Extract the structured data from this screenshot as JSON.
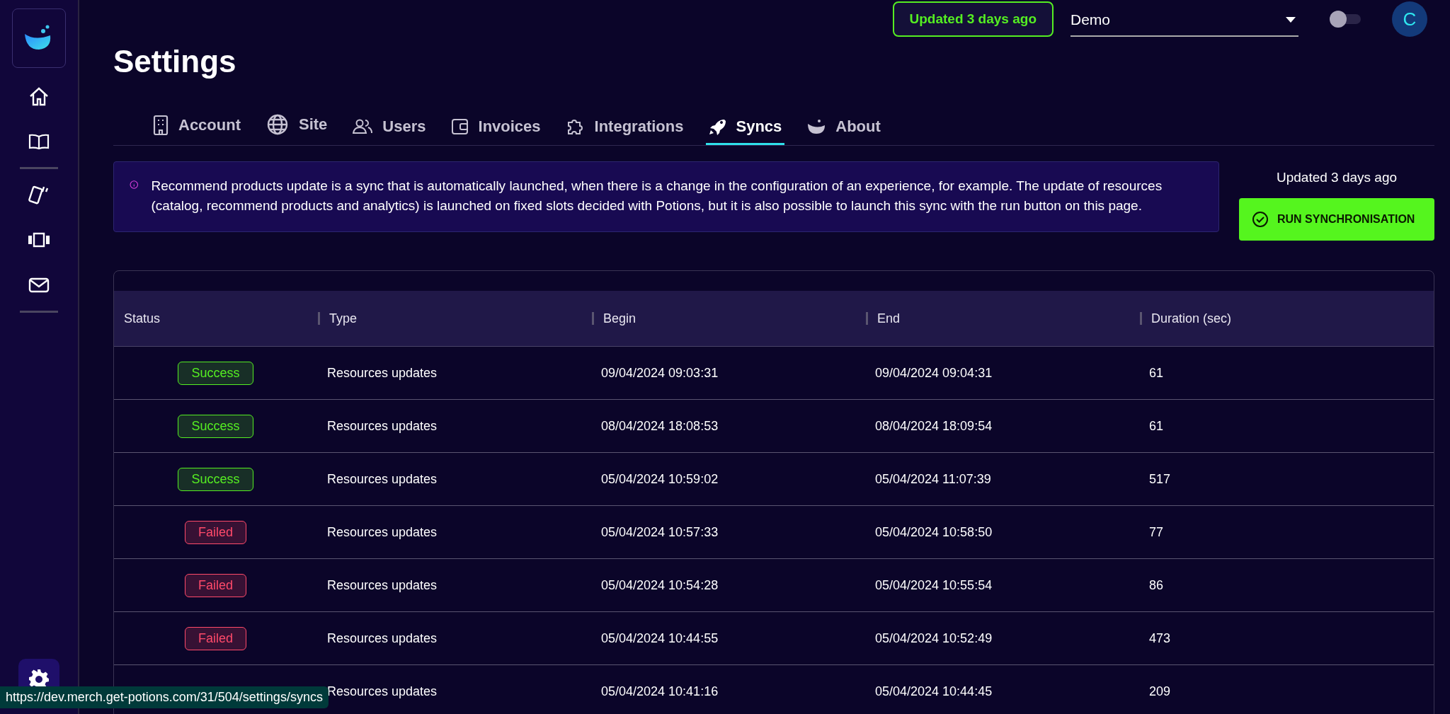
{
  "topbar": {
    "updated_badge": "Updated 3 days ago",
    "project_select": {
      "value": "Demo"
    },
    "theme_toggle": {
      "on": false
    },
    "avatar": "C"
  },
  "sidebar": {
    "items": [
      {
        "kind": "home"
      },
      {
        "kind": "book"
      },
      {
        "kind": "divider"
      },
      {
        "kind": "cards"
      },
      {
        "kind": "carousel"
      },
      {
        "kind": "mail"
      },
      {
        "kind": "divider"
      }
    ],
    "settings_selected": true
  },
  "page_title": "Settings",
  "tabs": [
    {
      "label": "Account",
      "selected": false
    },
    {
      "label": "Site",
      "selected": false
    },
    {
      "label": "Users",
      "selected": false
    },
    {
      "label": "Invoices",
      "selected": false
    },
    {
      "label": "Integrations",
      "selected": false
    },
    {
      "label": "Syncs",
      "selected": true
    },
    {
      "label": "About",
      "selected": false
    }
  ],
  "info": "Recommend products update is a sync that is automatically launched, when there is a change in the configuration of an experience, for example. The update of resources (catalog, recommend products and analytics) is launched on fixed slots decided with Potions, but it is also possible to launch this sync with the run button on this page.",
  "sync_panel": {
    "updated": "Updated 3 days ago",
    "run_button": "RUN SYNCHRONISATION"
  },
  "table": {
    "columns": [
      "Status",
      "Type",
      "Begin",
      "End",
      "Duration (sec)"
    ],
    "rows": [
      {
        "status": "Success",
        "color": "#55ee22",
        "type": "Resources updates",
        "begin": "09/04/2024 09:03:31",
        "end": "09/04/2024 09:04:31",
        "duration": "61"
      },
      {
        "status": "Success",
        "color": "#55ee22",
        "type": "Resources updates",
        "begin": "08/04/2024 18:08:53",
        "end": "08/04/2024 18:09:54",
        "duration": "61"
      },
      {
        "status": "Success",
        "color": "#55ee22",
        "type": "Resources updates",
        "begin": "05/04/2024 10:59:02",
        "end": "05/04/2024 11:07:39",
        "duration": "517"
      },
      {
        "status": "Failed",
        "color": "#ff4a6a",
        "type": "Resources updates",
        "begin": "05/04/2024 10:57:33",
        "end": "05/04/2024 10:58:50",
        "duration": "77"
      },
      {
        "status": "Failed",
        "color": "#ff4a6a",
        "type": "Resources updates",
        "begin": "05/04/2024 10:54:28",
        "end": "05/04/2024 10:55:54",
        "duration": "86"
      },
      {
        "status": "Failed",
        "color": "#ff4a6a",
        "type": "Resources updates",
        "begin": "05/04/2024 10:44:55",
        "end": "05/04/2024 10:52:49",
        "duration": "473"
      },
      {
        "type": "Resources updates",
        "begin": "05/04/2024 10:41:16",
        "end": "05/04/2024 10:44:45",
        "duration": "209"
      }
    ]
  },
  "status_url": "https://dev.merch.get-potions.com/31/504/settings/syncs"
}
